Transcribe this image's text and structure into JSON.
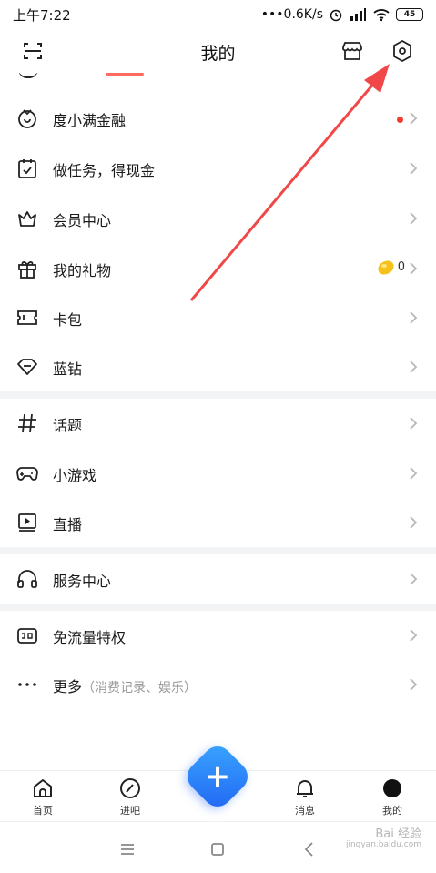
{
  "status": {
    "time": "上午7:22",
    "net": "•••0.6K/s",
    "battery": "45"
  },
  "header": {
    "title": "我的"
  },
  "menu": [
    {
      "label": "度小满金融",
      "icon": "finance-icon",
      "dot": true
    },
    {
      "label": "做任务，得现金",
      "icon": "task-calendar-icon"
    },
    {
      "label": "会员中心",
      "icon": "crown-icon"
    },
    {
      "label": "我的礼物",
      "icon": "gift-icon",
      "count": "0"
    },
    {
      "label": "卡包",
      "icon": "card-icon"
    },
    {
      "label": "蓝钻",
      "icon": "diamond-icon"
    },
    {
      "label": "话题",
      "icon": "hash-icon"
    },
    {
      "label": "小游戏",
      "icon": "gamepad-icon"
    },
    {
      "label": "直播",
      "icon": "live-play-icon"
    },
    {
      "label": "服务中心",
      "icon": "headphones-icon"
    },
    {
      "label": "免流量特权",
      "icon": "free-data-icon"
    },
    {
      "label": "更多",
      "sub": "（消费记录、娱乐）",
      "icon": "more-dots-icon"
    }
  ],
  "tabs": [
    {
      "label": "首页",
      "icon": "home-icon"
    },
    {
      "label": "进吧",
      "icon": "compass-icon"
    },
    {
      "label": "消息",
      "icon": "bell-icon"
    },
    {
      "label": "我的",
      "icon": "profile-icon"
    }
  ],
  "fab": {
    "label": "+"
  },
  "watermark": {
    "brand": "Bai 经验",
    "url": "jingyan.baidu.com"
  },
  "colors": {
    "accent": "#2f7df6",
    "dot": "#f23a2e",
    "arrow": "#f04848",
    "separator": "#f2f3f5"
  }
}
